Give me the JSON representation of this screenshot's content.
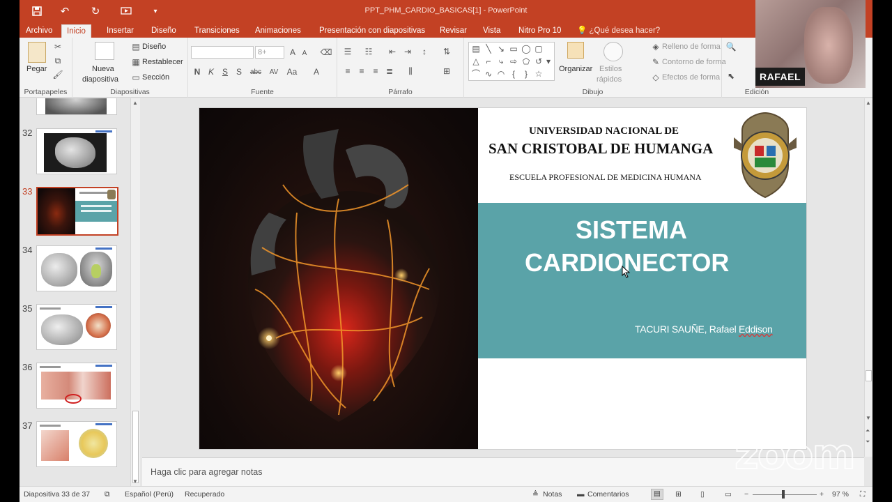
{
  "window": {
    "title": "PPT_PHM_CARDIO_BASICAS[1] - PowerPoint",
    "qat_icons": [
      "save-icon",
      "undo-icon",
      "redo-icon",
      "start-from-beginning-icon",
      "customize-qat-icon"
    ]
  },
  "tabs": [
    {
      "label": "Archivo"
    },
    {
      "label": "Inicio",
      "active": true
    },
    {
      "label": "Insertar"
    },
    {
      "label": "Diseño"
    },
    {
      "label": "Transiciones"
    },
    {
      "label": "Animaciones"
    },
    {
      "label": "Presentación con diapositivas"
    },
    {
      "label": "Revisar"
    },
    {
      "label": "Vista"
    },
    {
      "label": "Nitro Pro 10"
    }
  ],
  "tell_me": "¿Qué desea hacer?",
  "ribbon": {
    "portapapeles": {
      "label": "Portapapeles",
      "paste": "Pegar"
    },
    "diapositivas": {
      "label": "Diapositivas",
      "new_slide_1": "Nueva",
      "new_slide_2": "diapositiva",
      "layout": "Diseño",
      "reset": "Restablecer",
      "section": "Sección"
    },
    "fuente": {
      "label": "Fuente",
      "size": "8+",
      "bold": "N",
      "italic": "K",
      "underline": "S",
      "shadow": "S",
      "strike": "abc",
      "spacing": "AV",
      "case": "Aa",
      "color": "A",
      "grow": "A",
      "shrink": "A"
    },
    "parrafo": {
      "label": "Párrafo"
    },
    "dibujo": {
      "label": "Dibujo",
      "organize": "Organizar",
      "styles_1": "Estilos",
      "styles_2": "rápidos",
      "fill": "Relleno de forma",
      "outline": "Contorno de forma",
      "effects": "Efectos de forma"
    },
    "edicion": {
      "label": "Edición"
    }
  },
  "thumbnails": [
    {
      "num": "",
      "active": false
    },
    {
      "num": "32",
      "active": false
    },
    {
      "num": "33",
      "active": true
    },
    {
      "num": "34",
      "active": false
    },
    {
      "num": "35",
      "active": false
    },
    {
      "num": "36",
      "active": false
    },
    {
      "num": "37",
      "active": false
    }
  ],
  "slide": {
    "university_1": "UNIVERSIDAD NACIONAL DE",
    "university_2": "SAN CRISTOBAL DE HUMANGA",
    "school": "ESCUELA PROFESIONAL DE MEDICINA HUMANA",
    "title_1": "SISTEMA",
    "title_2": "CARDIONECTOR",
    "author_prefix": "TACURI SAUÑE, Rafael ",
    "author_suffix": "Eddison",
    "teal_color": "#5aa3a8"
  },
  "notes_placeholder": "Haga clic para agregar notas",
  "status": {
    "slide_info": "Diapositiva 33 de 37",
    "language": "Español (Perú)",
    "recovered": "Recuperado",
    "notes": "Notas",
    "comments": "Comentarios",
    "zoom": "97 %"
  },
  "webcam": {
    "name": "RAFAEL"
  },
  "overlay": {
    "logo": "zoom"
  },
  "colors": {
    "accent": "#c34124",
    "ribbon_bg": "#f3f3f3"
  }
}
